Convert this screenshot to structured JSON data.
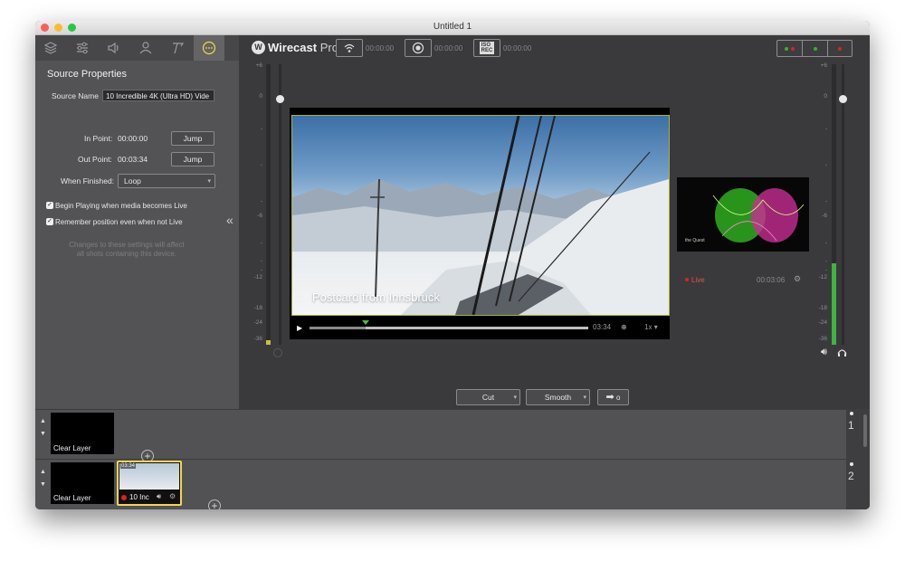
{
  "window": {
    "title": "Untitled 1"
  },
  "logo": {
    "brand": "Wirecast",
    "edition": "Pro"
  },
  "toolbar": {
    "stream_time": "00:00:00",
    "record_time": "00:00:00",
    "iso_label_top": "ISO",
    "iso_label_bottom": "REC",
    "iso_time": "00:00:00"
  },
  "tabs": [
    "layers-icon",
    "sliders-icon",
    "audio-icon",
    "user-icon",
    "text-icon",
    "more-icon"
  ],
  "source_properties": {
    "title": "Source Properties",
    "source_name_label": "Source Name",
    "source_name_value": "10 Incredible 4K (Ultra HD) Vide",
    "in_point_label": "In Point:",
    "in_point_value": "00:00:00",
    "out_point_label": "Out Point:",
    "out_point_value": "00:03:34",
    "jump_label": "Jump",
    "when_finished_label": "When Finished:",
    "when_finished_value": "Loop",
    "begin_playing_label": "Begin Playing when media becomes Live",
    "remember_position_label": "Remember position even when not Live",
    "note": "Changes to these settings will affect all shots containing this device."
  },
  "meter_ticks": [
    "+6",
    "0",
    "-",
    "-",
    "-",
    "-6",
    "-",
    "-",
    "-",
    "-12",
    "-18",
    "-24",
    "-36"
  ],
  "preview": {
    "caption": "Postcard from Innsbruck",
    "duration": "03:34",
    "speed": "1x",
    "progress": 0.2
  },
  "live": {
    "label": "Live",
    "time": "00:03:06",
    "thumb_text": "the Quest"
  },
  "transitions": {
    "cut_label": "Cut",
    "smooth_label": "Smooth"
  },
  "layers": {
    "rows": [
      {
        "number": "1",
        "clear_label": "Clear Layer"
      },
      {
        "number": "2",
        "clear_label": "Clear Layer",
        "shot_time": "03:34",
        "shot_label": "10 Inc"
      }
    ]
  },
  "colors": {
    "accent": "#f2d64b",
    "live": "#e02020",
    "meter": "#3fb43f"
  }
}
